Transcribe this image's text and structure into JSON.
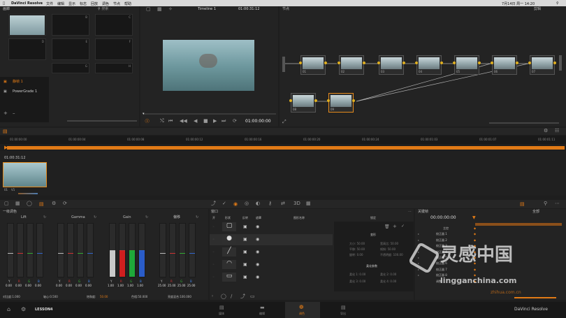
{
  "menubar": {
    "app_name": "DaVinci Resolve",
    "items": [
      "文件",
      "编辑",
      "显示",
      "标志",
      "回放",
      "调色",
      "节点",
      "帮助"
    ],
    "clock": "7月14日 周一 14:20"
  },
  "gallery": {
    "title": "画廊",
    "search_placeholder": "搜索",
    "still_labels": [
      "A",
      "B",
      "C",
      "D",
      "E",
      "F",
      "G",
      "H"
    ],
    "albums": [
      {
        "label": "静帧 1",
        "active": true
      },
      {
        "label": "PowerGrade 1",
        "active": false
      }
    ]
  },
  "viewer": {
    "timeline_name": "Timeline 1",
    "timecode_top": "01:00:31:12",
    "timecode": "01:00:00:00"
  },
  "nodes": {
    "title": "节点",
    "mode": "剪辑",
    "labels": [
      "01",
      "02",
      "03",
      "04",
      "05",
      "06",
      "07",
      "08",
      "09"
    ]
  },
  "timeline": {
    "ruler": [
      "01:00:00:00",
      "01:00:00:04",
      "01:00:00:08",
      "01:00:00:12",
      "01:00:00:16",
      "01:00:00:20",
      "01:00:00:24",
      "01:00:01:03",
      "01:00:01:07",
      "01:00:01:11"
    ],
    "clip_timecode": "01:00:31:12",
    "clip_label": "01",
    "clip_track": "V1"
  },
  "color_wheels": {
    "title": "一级调色",
    "wheels": [
      {
        "name": "Lift",
        "y": "0.00",
        "r": "0.00",
        "g": "0.00",
        "b": "0.00"
      },
      {
        "name": "Gamma",
        "y": "0.00",
        "r": "0.00",
        "g": "0.00",
        "b": "0.00"
      },
      {
        "name": "Gain",
        "y": "1.00",
        "r": "1.00",
        "g": "1.00",
        "b": "1.00"
      },
      {
        "name": "偏移",
        "y": "25.00",
        "r": "25.00",
        "g": "25.00",
        "b": "25.00"
      }
    ],
    "channel_letters": [
      "Y",
      "R",
      "G",
      "B"
    ],
    "footer": {
      "contrast": "对比度:1.000",
      "pivot": "轴心:0.500",
      "saturation_label": "饱和度:",
      "saturation_value": "50.00",
      "hue": "色相:50.000",
      "lum_mix": "亮度混合:100.000"
    }
  },
  "window_panel": {
    "title": "窗口",
    "columns": [
      "开",
      "形状",
      "反转",
      "遮罩",
      "图形名称"
    ],
    "tracking_label": "锁定",
    "transform_label": "变形",
    "softness_label": "柔化参数",
    "transform_fields": [
      "大小: 50.00",
      "宽高比: 50.00",
      "平移: 50.00",
      "倾斜: 50.00",
      "旋转: 0.00",
      "不透明度: 100.00"
    ],
    "softness_fields": [
      "柔化 1: 0.00",
      "柔化 2: 0.00",
      "柔化 3: 0.00",
      "柔化 4: 0.00"
    ]
  },
  "keyframes": {
    "title": "关键帧",
    "mode": "全部",
    "timecode": "00:00:00:00",
    "tracks": [
      "主控",
      "校正器 1",
      "校正器 2",
      "校正器 3",
      "校正器 4",
      "校正器 5",
      "校正器 6",
      "校正器 7",
      "校正器 8",
      "调整"
    ]
  },
  "bottom": {
    "project": "LESSON4",
    "pages": [
      {
        "label": "媒体",
        "active": false
      },
      {
        "label": "编辑",
        "active": false
      },
      {
        "label": "调色",
        "active": true
      },
      {
        "label": "导出",
        "active": false
      }
    ],
    "brand": "DaVinci Resolve"
  },
  "watermark": {
    "text1": "灵感中国",
    "text2": "lingganchina.com",
    "text3": "zhihua.com.cn"
  },
  "colors": {
    "accent": "#e07a16",
    "selection": "#e58a1c"
  }
}
